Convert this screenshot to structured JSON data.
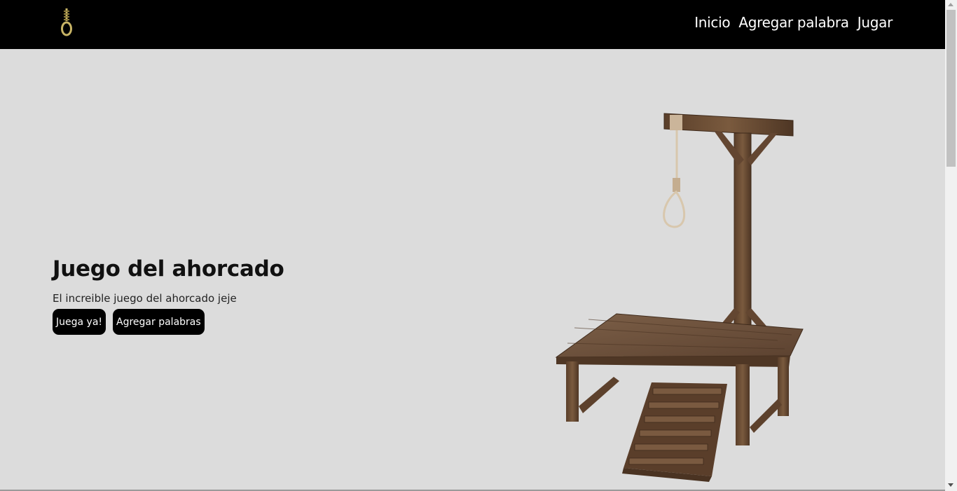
{
  "nav": {
    "logo_icon": "noose-icon",
    "items": [
      "Inicio",
      "Agregar palabra",
      "Jugar"
    ]
  },
  "hero": {
    "title": "Juego del ahorcado",
    "subtitle": "El increible juego del ahorcado jeje",
    "buttons": {
      "play": "Juega ya!",
      "add": "Agregar palabras"
    },
    "illustration": "gallows-illustration"
  },
  "colors": {
    "header": "#000000",
    "background": "#dcdcdc",
    "button": "#000000",
    "logo": "#c8b465",
    "wood": "#6b4e34"
  }
}
